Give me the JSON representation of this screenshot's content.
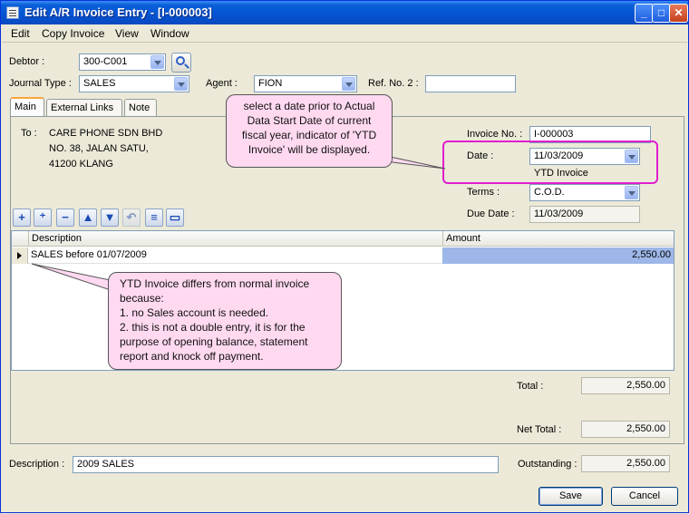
{
  "window": {
    "title": "Edit A/R Invoice Entry - [I-000003]"
  },
  "menu": [
    "Edit",
    "Copy Invoice",
    "View",
    "Window"
  ],
  "header": {
    "debtor_label": "Debtor :",
    "debtor_value": "300-C001",
    "journal_type_label": "Journal Type :",
    "journal_type_value": "SALES",
    "agent_label": "Agent :",
    "agent_value": "FION",
    "ref_no2_label": "Ref. No. 2 :",
    "ref_no2_value": ""
  },
  "tabs": [
    "Main",
    "External Links",
    "Note"
  ],
  "address": {
    "to_label": "To :",
    "lines": [
      "CARE PHONE SDN BHD",
      "NO. 38, JALAN SATU,",
      "41200 KLANG"
    ]
  },
  "invoice": {
    "invoice_no_label": "Invoice No. :",
    "invoice_no_value": "I-000003",
    "date_label": "Date :",
    "date_value": "11/03/2009",
    "ytd_indicator": "YTD Invoice",
    "terms_label": "Terms :",
    "terms_value": "C.O.D.",
    "due_date_label": "Due Date :",
    "due_date_value": "11/03/2009"
  },
  "toolbar_icons": [
    "add-row-icon",
    "insert-row-icon",
    "delete-row-icon",
    "move-up-icon",
    "move-down-icon",
    "undo-icon",
    "list-icon",
    "detail-icon"
  ],
  "grid": {
    "columns": [
      "Description",
      "Amount"
    ],
    "rows": [
      {
        "description": "SALES before 01/07/2009",
        "amount": "2,550.00"
      }
    ]
  },
  "totals": {
    "total_label": "Total :",
    "total_value": "2,550.00",
    "net_total_label": "Net Total :",
    "net_total_value": "2,550.00",
    "outstanding_label": "Outstanding :",
    "outstanding_value": "2,550.00"
  },
  "footer": {
    "description_label": "Description :",
    "description_value": "2009 SALES",
    "save_label": "Save",
    "cancel_label": "Cancel"
  },
  "callouts": {
    "date_note": "select a date prior to Actual Data Start Date of current fiscal year, indicator of 'YTD Invoice' will be displayed.",
    "ytd_note_intro": "YTD Invoice differs from normal invoice because:",
    "ytd_note_1": "1. no Sales account is needed.",
    "ytd_note_2": "2. this is not a double entry, it is for the purpose of opening balance, statement report and knock off payment."
  },
  "colors": {
    "titlebar": "#0553d1",
    "callout_fill": "#ffd9f0",
    "highlight": "#e01ecf",
    "selected_cell": "#9db7e8"
  }
}
